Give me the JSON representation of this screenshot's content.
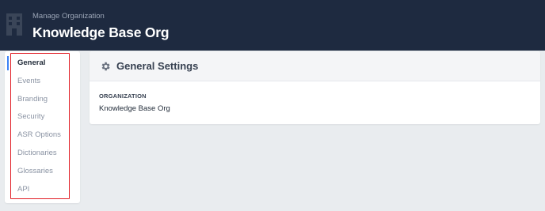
{
  "header": {
    "subtitle": "Manage Organization",
    "title": "Knowledge Base Org",
    "icon": "building-icon"
  },
  "sidebar": {
    "items": [
      {
        "label": "General",
        "active": true
      },
      {
        "label": "Events",
        "active": false
      },
      {
        "label": "Branding",
        "active": false
      },
      {
        "label": "Security",
        "active": false
      },
      {
        "label": "ASR Options",
        "active": false
      },
      {
        "label": "Dictionaries",
        "active": false
      },
      {
        "label": "Glossaries",
        "active": false
      },
      {
        "label": "API",
        "active": false
      }
    ]
  },
  "card": {
    "icon": "gear-icon",
    "title": "General Settings",
    "organization_label": "ORGANIZATION",
    "organization_value": "Knowledge Base Org"
  },
  "colors": {
    "header_bg": "#1e2a40",
    "page_bg": "#e9ecef",
    "active_indicator": "#3b82f6",
    "highlight_border": "#e11d24"
  }
}
